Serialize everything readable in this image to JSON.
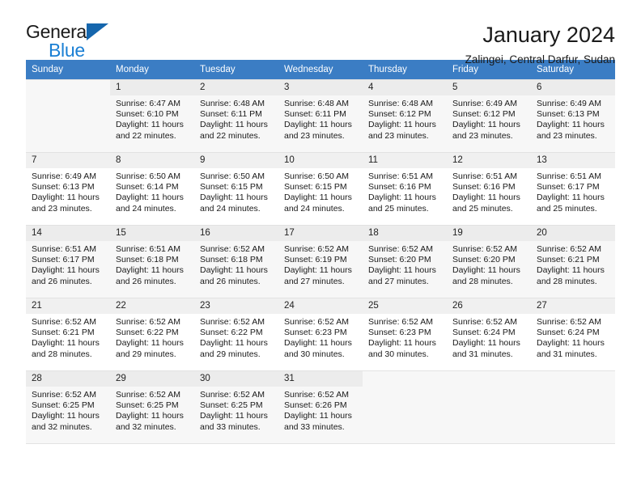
{
  "brand": {
    "name_part1": "General",
    "name_part2": "Blue",
    "accent_color": "#1a7fd4",
    "triangle_color": "#1566ad"
  },
  "header": {
    "month_title": "January 2024",
    "location": "Zalingei, Central Darfur, Sudan",
    "header_bg_color": "#3b7dc4"
  },
  "weekday_headers": [
    "Sunday",
    "Monday",
    "Tuesday",
    "Wednesday",
    "Thursday",
    "Friday",
    "Saturday"
  ],
  "weeks": [
    {
      "shaded": true,
      "days": [
        {
          "number": "",
          "sunrise": "",
          "sunset": "",
          "daylight_line1": "",
          "daylight_line2": "",
          "empty": true
        },
        {
          "number": "1",
          "sunrise": "Sunrise: 6:47 AM",
          "sunset": "Sunset: 6:10 PM",
          "daylight_line1": "Daylight: 11 hours",
          "daylight_line2": "and 22 minutes.",
          "empty": false
        },
        {
          "number": "2",
          "sunrise": "Sunrise: 6:48 AM",
          "sunset": "Sunset: 6:11 PM",
          "daylight_line1": "Daylight: 11 hours",
          "daylight_line2": "and 22 minutes.",
          "empty": false
        },
        {
          "number": "3",
          "sunrise": "Sunrise: 6:48 AM",
          "sunset": "Sunset: 6:11 PM",
          "daylight_line1": "Daylight: 11 hours",
          "daylight_line2": "and 23 minutes.",
          "empty": false
        },
        {
          "number": "4",
          "sunrise": "Sunrise: 6:48 AM",
          "sunset": "Sunset: 6:12 PM",
          "daylight_line1": "Daylight: 11 hours",
          "daylight_line2": "and 23 minutes.",
          "empty": false
        },
        {
          "number": "5",
          "sunrise": "Sunrise: 6:49 AM",
          "sunset": "Sunset: 6:12 PM",
          "daylight_line1": "Daylight: 11 hours",
          "daylight_line2": "and 23 minutes.",
          "empty": false
        },
        {
          "number": "6",
          "sunrise": "Sunrise: 6:49 AM",
          "sunset": "Sunset: 6:13 PM",
          "daylight_line1": "Daylight: 11 hours",
          "daylight_line2": "and 23 minutes.",
          "empty": false
        }
      ]
    },
    {
      "shaded": false,
      "days": [
        {
          "number": "7",
          "sunrise": "Sunrise: 6:49 AM",
          "sunset": "Sunset: 6:13 PM",
          "daylight_line1": "Daylight: 11 hours",
          "daylight_line2": "and 23 minutes.",
          "empty": false
        },
        {
          "number": "8",
          "sunrise": "Sunrise: 6:50 AM",
          "sunset": "Sunset: 6:14 PM",
          "daylight_line1": "Daylight: 11 hours",
          "daylight_line2": "and 24 minutes.",
          "empty": false
        },
        {
          "number": "9",
          "sunrise": "Sunrise: 6:50 AM",
          "sunset": "Sunset: 6:15 PM",
          "daylight_line1": "Daylight: 11 hours",
          "daylight_line2": "and 24 minutes.",
          "empty": false
        },
        {
          "number": "10",
          "sunrise": "Sunrise: 6:50 AM",
          "sunset": "Sunset: 6:15 PM",
          "daylight_line1": "Daylight: 11 hours",
          "daylight_line2": "and 24 minutes.",
          "empty": false
        },
        {
          "number": "11",
          "sunrise": "Sunrise: 6:51 AM",
          "sunset": "Sunset: 6:16 PM",
          "daylight_line1": "Daylight: 11 hours",
          "daylight_line2": "and 25 minutes.",
          "empty": false
        },
        {
          "number": "12",
          "sunrise": "Sunrise: 6:51 AM",
          "sunset": "Sunset: 6:16 PM",
          "daylight_line1": "Daylight: 11 hours",
          "daylight_line2": "and 25 minutes.",
          "empty": false
        },
        {
          "number": "13",
          "sunrise": "Sunrise: 6:51 AM",
          "sunset": "Sunset: 6:17 PM",
          "daylight_line1": "Daylight: 11 hours",
          "daylight_line2": "and 25 minutes.",
          "empty": false
        }
      ]
    },
    {
      "shaded": true,
      "days": [
        {
          "number": "14",
          "sunrise": "Sunrise: 6:51 AM",
          "sunset": "Sunset: 6:17 PM",
          "daylight_line1": "Daylight: 11 hours",
          "daylight_line2": "and 26 minutes.",
          "empty": false
        },
        {
          "number": "15",
          "sunrise": "Sunrise: 6:51 AM",
          "sunset": "Sunset: 6:18 PM",
          "daylight_line1": "Daylight: 11 hours",
          "daylight_line2": "and 26 minutes.",
          "empty": false
        },
        {
          "number": "16",
          "sunrise": "Sunrise: 6:52 AM",
          "sunset": "Sunset: 6:18 PM",
          "daylight_line1": "Daylight: 11 hours",
          "daylight_line2": "and 26 minutes.",
          "empty": false
        },
        {
          "number": "17",
          "sunrise": "Sunrise: 6:52 AM",
          "sunset": "Sunset: 6:19 PM",
          "daylight_line1": "Daylight: 11 hours",
          "daylight_line2": "and 27 minutes.",
          "empty": false
        },
        {
          "number": "18",
          "sunrise": "Sunrise: 6:52 AM",
          "sunset": "Sunset: 6:20 PM",
          "daylight_line1": "Daylight: 11 hours",
          "daylight_line2": "and 27 minutes.",
          "empty": false
        },
        {
          "number": "19",
          "sunrise": "Sunrise: 6:52 AM",
          "sunset": "Sunset: 6:20 PM",
          "daylight_line1": "Daylight: 11 hours",
          "daylight_line2": "and 28 minutes.",
          "empty": false
        },
        {
          "number": "20",
          "sunrise": "Sunrise: 6:52 AM",
          "sunset": "Sunset: 6:21 PM",
          "daylight_line1": "Daylight: 11 hours",
          "daylight_line2": "and 28 minutes.",
          "empty": false
        }
      ]
    },
    {
      "shaded": false,
      "days": [
        {
          "number": "21",
          "sunrise": "Sunrise: 6:52 AM",
          "sunset": "Sunset: 6:21 PM",
          "daylight_line1": "Daylight: 11 hours",
          "daylight_line2": "and 28 minutes.",
          "empty": false
        },
        {
          "number": "22",
          "sunrise": "Sunrise: 6:52 AM",
          "sunset": "Sunset: 6:22 PM",
          "daylight_line1": "Daylight: 11 hours",
          "daylight_line2": "and 29 minutes.",
          "empty": false
        },
        {
          "number": "23",
          "sunrise": "Sunrise: 6:52 AM",
          "sunset": "Sunset: 6:22 PM",
          "daylight_line1": "Daylight: 11 hours",
          "daylight_line2": "and 29 minutes.",
          "empty": false
        },
        {
          "number": "24",
          "sunrise": "Sunrise: 6:52 AM",
          "sunset": "Sunset: 6:23 PM",
          "daylight_line1": "Daylight: 11 hours",
          "daylight_line2": "and 30 minutes.",
          "empty": false
        },
        {
          "number": "25",
          "sunrise": "Sunrise: 6:52 AM",
          "sunset": "Sunset: 6:23 PM",
          "daylight_line1": "Daylight: 11 hours",
          "daylight_line2": "and 30 minutes.",
          "empty": false
        },
        {
          "number": "26",
          "sunrise": "Sunrise: 6:52 AM",
          "sunset": "Sunset: 6:24 PM",
          "daylight_line1": "Daylight: 11 hours",
          "daylight_line2": "and 31 minutes.",
          "empty": false
        },
        {
          "number": "27",
          "sunrise": "Sunrise: 6:52 AM",
          "sunset": "Sunset: 6:24 PM",
          "daylight_line1": "Daylight: 11 hours",
          "daylight_line2": "and 31 minutes.",
          "empty": false
        }
      ]
    },
    {
      "shaded": true,
      "days": [
        {
          "number": "28",
          "sunrise": "Sunrise: 6:52 AM",
          "sunset": "Sunset: 6:25 PM",
          "daylight_line1": "Daylight: 11 hours",
          "daylight_line2": "and 32 minutes.",
          "empty": false
        },
        {
          "number": "29",
          "sunrise": "Sunrise: 6:52 AM",
          "sunset": "Sunset: 6:25 PM",
          "daylight_line1": "Daylight: 11 hours",
          "daylight_line2": "and 32 minutes.",
          "empty": false
        },
        {
          "number": "30",
          "sunrise": "Sunrise: 6:52 AM",
          "sunset": "Sunset: 6:25 PM",
          "daylight_line1": "Daylight: 11 hours",
          "daylight_line2": "and 33 minutes.",
          "empty": false
        },
        {
          "number": "31",
          "sunrise": "Sunrise: 6:52 AM",
          "sunset": "Sunset: 6:26 PM",
          "daylight_line1": "Daylight: 11 hours",
          "daylight_line2": "and 33 minutes.",
          "empty": false
        },
        {
          "number": "",
          "sunrise": "",
          "sunset": "",
          "daylight_line1": "",
          "daylight_line2": "",
          "empty": true
        },
        {
          "number": "",
          "sunrise": "",
          "sunset": "",
          "daylight_line1": "",
          "daylight_line2": "",
          "empty": true
        },
        {
          "number": "",
          "sunrise": "",
          "sunset": "",
          "daylight_line1": "",
          "daylight_line2": "",
          "empty": true
        }
      ]
    }
  ]
}
